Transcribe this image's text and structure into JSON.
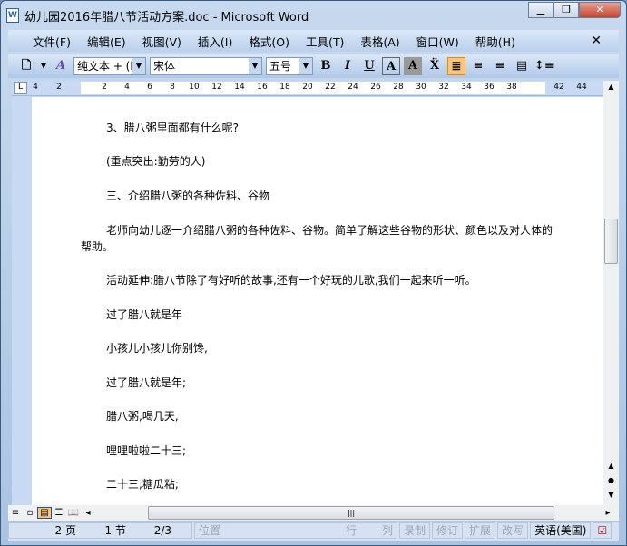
{
  "window": {
    "title": "幼儿园2016年腊八节活动方案.doc - Microsoft Word"
  },
  "menu": [
    "文件(F)",
    "编辑(E)",
    "视图(V)",
    "插入(I)",
    "格式(O)",
    "工具(T)",
    "表格(A)",
    "窗口(W)",
    "帮助(H)"
  ],
  "toolbar": {
    "style": "纯文本 + (i",
    "font": "宋体",
    "size": "五号",
    "bold": "B",
    "italic": "I",
    "underline": "U",
    "char_border": "A",
    "char_shade": "A"
  },
  "ruler": [
    "4",
    "2",
    "2",
    "4",
    "6",
    "8",
    "10",
    "12",
    "14",
    "16",
    "18",
    "20",
    "22",
    "24",
    "26",
    "28",
    "30",
    "32",
    "34",
    "36",
    "38",
    "42",
    "44"
  ],
  "paragraphs": [
    "3、腊八粥里面都有什么呢?",
    "(重点突出:勤劳的人)",
    "三、介绍腊八粥的各种佐料、谷物",
    "老师向幼儿逐一介绍腊八粥的各种佐料、谷物。简单了解这些谷物的形状、颜色以及对人体的帮助。",
    "活动延伸:腊八节除了有好听的故事,还有一个好玩的儿歌,我们一起来听一听。",
    "过了腊八就是年",
    "小孩儿小孩儿你别馋,",
    "过了腊八就是年;",
    "腊八粥,喝几天,",
    "哩哩啦啦二十三;",
    "二十三,糖瓜粘;"
  ],
  "status": {
    "page": "2 页",
    "section": "1 节",
    "pages": "2/3",
    "position": "位置",
    "line": "行",
    "col": "列",
    "rec": "录制",
    "trk": "修订",
    "ext": "扩展",
    "ovr": "改写",
    "lang": "英语(美国)"
  }
}
